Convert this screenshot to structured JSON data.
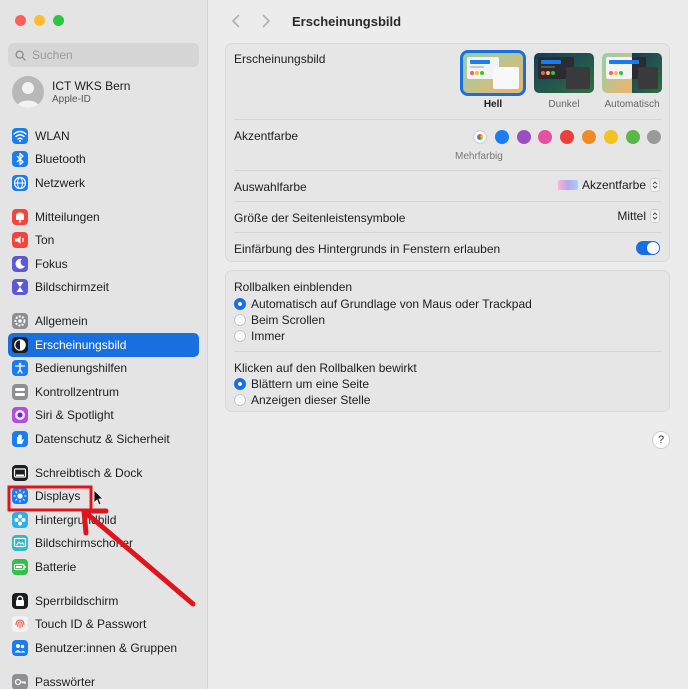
{
  "sidebar": {
    "search_placeholder": "Suchen",
    "account": {
      "name": "ICT WKS Bern",
      "subtitle": "Apple-ID"
    },
    "groups": [
      [
        {
          "label": "WLAN",
          "icon": "wifi-icon",
          "color": "#1a7cf2"
        },
        {
          "label": "Bluetooth",
          "icon": "bluetooth-icon",
          "color": "#1a7cf2"
        },
        {
          "label": "Netzwerk",
          "icon": "globe-icon",
          "color": "#1a7cf2"
        }
      ],
      [
        {
          "label": "Mitteilungen",
          "icon": "bell-icon",
          "color": "#f0463d"
        },
        {
          "label": "Ton",
          "icon": "speaker-icon",
          "color": "#f0463d"
        },
        {
          "label": "Fokus",
          "icon": "moon-icon",
          "color": "#5c59d6"
        },
        {
          "label": "Bildschirmzeit",
          "icon": "hourglass-icon",
          "color": "#5c59d6"
        }
      ],
      [
        {
          "label": "Allgemein",
          "icon": "gear-icon",
          "color": "#8e8e93"
        },
        {
          "label": "Erscheinungsbild",
          "icon": "appearance-icon",
          "color": "#1d1d1f",
          "active": true
        },
        {
          "label": "Bedienungshilfen",
          "icon": "accessibility-icon",
          "color": "#1a7cf2"
        },
        {
          "label": "Kontrollzentrum",
          "icon": "control-center-icon",
          "color": "#8e8e93"
        },
        {
          "label": "Siri & Spotlight",
          "icon": "siri-icon",
          "color": "#b14fd6"
        },
        {
          "label": "Datenschutz & Sicherheit",
          "icon": "hand-icon",
          "color": "#1a7cf2"
        }
      ],
      [
        {
          "label": "Schreibtisch & Dock",
          "icon": "dock-icon",
          "color": "#1d1d1f"
        },
        {
          "label": "Displays",
          "icon": "sun-icon",
          "color": "#1a7cf2"
        },
        {
          "label": "Hintergrundbild",
          "icon": "flower-icon",
          "color": "#2fb0e8"
        },
        {
          "label": "Bildschirmschoner",
          "icon": "screensaver-icon",
          "color": "#2fb8c8"
        },
        {
          "label": "Batterie",
          "icon": "battery-icon",
          "color": "#33c04a"
        }
      ],
      [
        {
          "label": "Sperrbildschirm",
          "icon": "lock-icon",
          "color": "#1d1d1f"
        },
        {
          "label": "Touch ID & Passwort",
          "icon": "fingerprint-icon",
          "color": "#f2f2f2"
        },
        {
          "label": "Benutzer:innen & Gruppen",
          "icon": "users-icon",
          "color": "#1a7cf2"
        }
      ],
      [
        {
          "label": "Passwörter",
          "icon": "key-icon",
          "color": "#8e8e93"
        }
      ]
    ]
  },
  "toolbar": {
    "title": "Erscheinungsbild"
  },
  "appearance": {
    "label": "Erscheinungsbild",
    "options": [
      {
        "label": "Hell",
        "selected": true
      },
      {
        "label": "Dunkel",
        "selected": false
      },
      {
        "label": "Automatisch",
        "selected": false
      }
    ]
  },
  "accent": {
    "label": "Akzentfarbe",
    "caption": "Mehrfarbig",
    "colors": [
      "#ff6bd0",
      "#1a7cf2",
      "#9a4fc0",
      "#e84fa0",
      "#e8403a",
      "#f08a25",
      "#f4c321",
      "#5bb846",
      "#9a9a9a"
    ]
  },
  "highlight": {
    "label": "Auswahlfarbe",
    "value": "Akzentfarbe"
  },
  "sidebar_icon_size": {
    "label": "Größe der Seitenleistensymbole",
    "value": "Mittel"
  },
  "wallpaper_tint": {
    "label": "Einfärbung des Hintergrunds in Fenstern erlauben",
    "on": true
  },
  "scrollbars": {
    "label": "Rollbalken einblenden",
    "options": [
      {
        "label": "Automatisch auf Grundlage von Maus oder Trackpad",
        "selected": true
      },
      {
        "label": "Beim Scrollen",
        "selected": false
      },
      {
        "label": "Immer",
        "selected": false
      }
    ]
  },
  "scroll_click": {
    "label": "Klicken auf den Rollbalken bewirkt",
    "options": [
      {
        "label": "Blättern um eine Seite",
        "selected": true
      },
      {
        "label": "Anzeigen dieser Stelle",
        "selected": false
      }
    ]
  },
  "help_label": "?",
  "annotation_color": "#e0141c"
}
